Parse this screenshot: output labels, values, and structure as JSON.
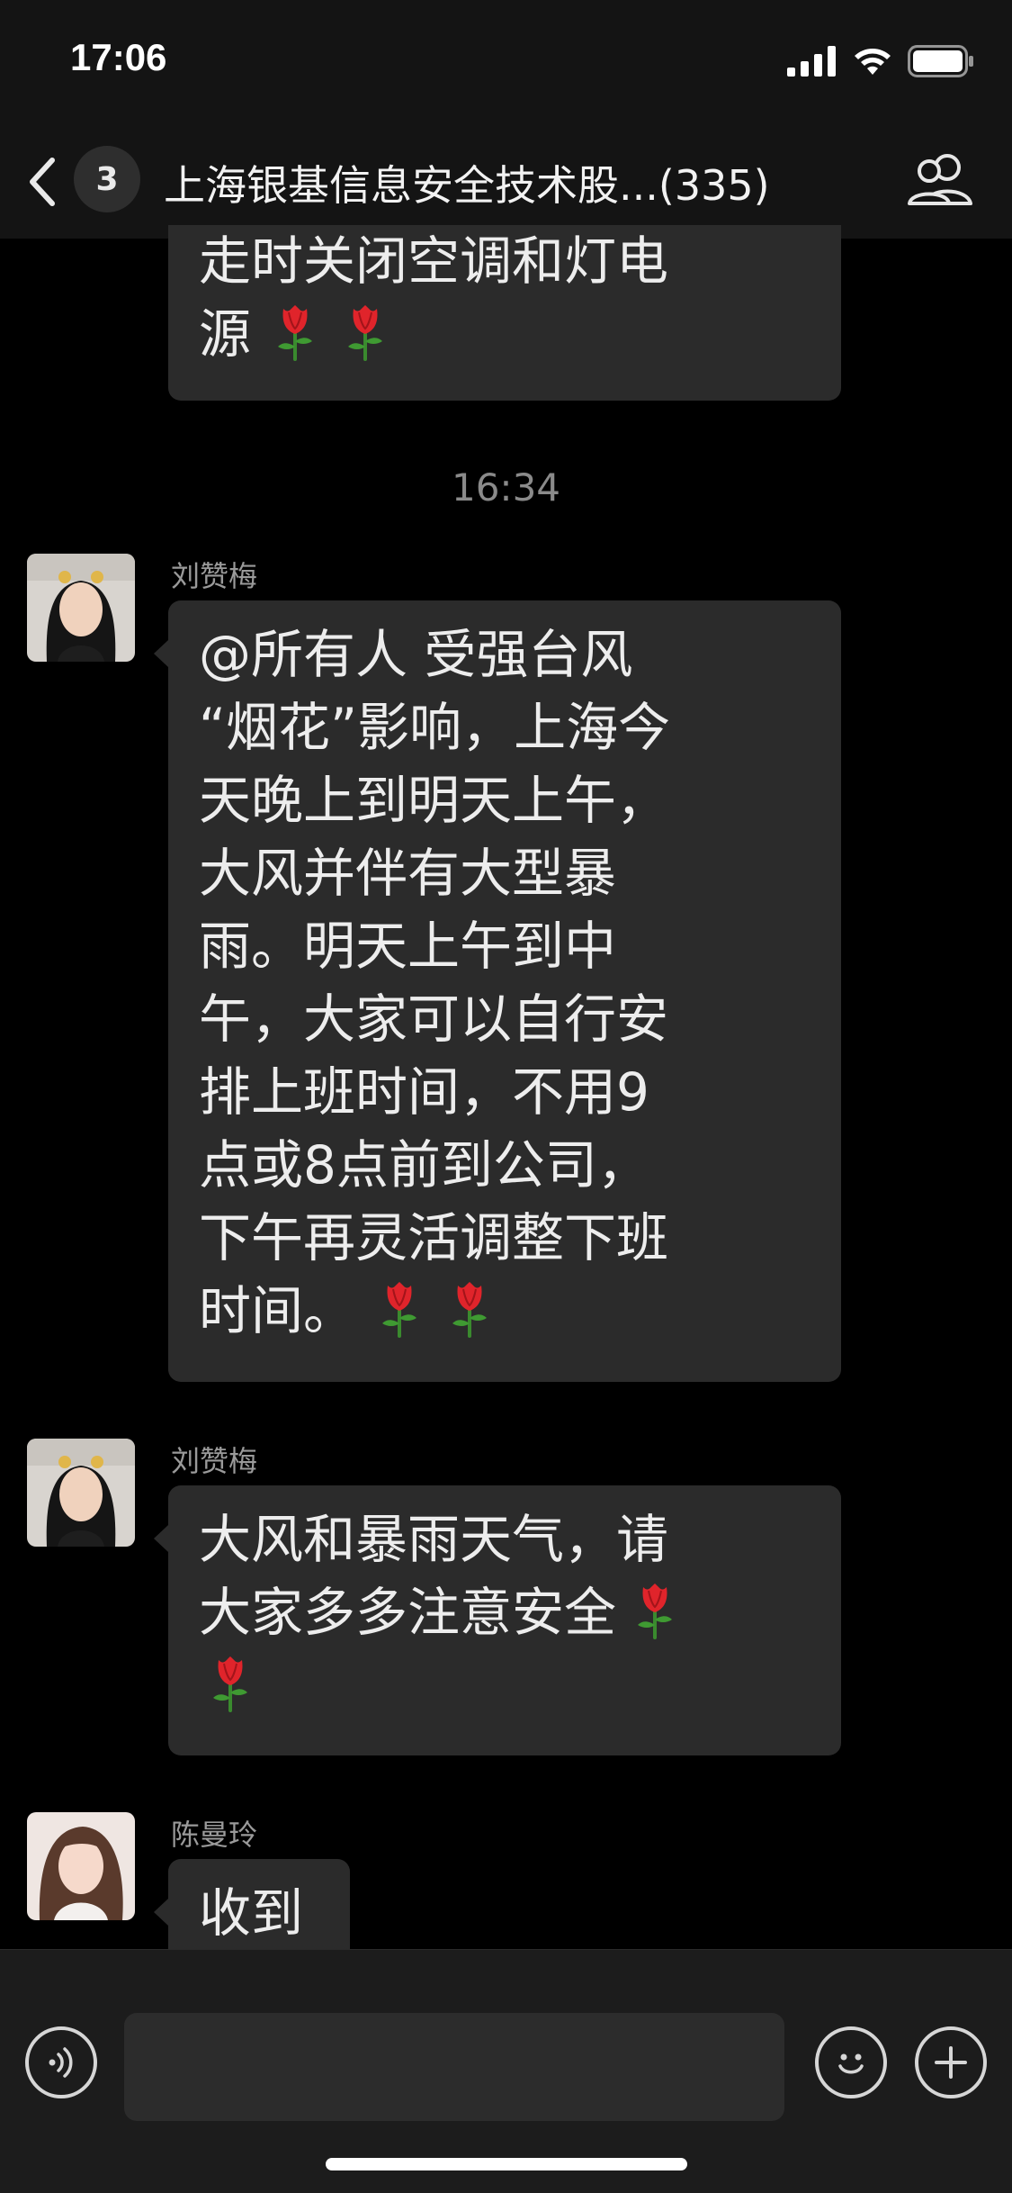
{
  "status_bar": {
    "time": "17:06"
  },
  "nav": {
    "unread_count": "3",
    "title": "上海银基信息安全技术股...(335)"
  },
  "messages": [
    {
      "sender": "",
      "lines": [
        "走时关闭空调和灯电",
        "源"
      ],
      "emoji_after": [
        "rose",
        "rose"
      ]
    },
    {
      "time_divider": "16:34"
    },
    {
      "sender": "刘赞梅",
      "lines": [
        "@所有人 受强台风",
        "“烟花”影响，上海今",
        "天晚上到明天上午，",
        "大风并伴有大型暴",
        "雨。明天上午到中",
        "午，大家可以自行安",
        "排上班时间，不用9",
        "点或8点前到公司，",
        "下午再灵活调整下班",
        "时间。"
      ],
      "emoji_after": [
        "rose",
        "rose"
      ]
    },
    {
      "sender": "刘赞梅",
      "lines": [
        "大风和暴雨天气，请",
        "大家多多注意安全"
      ],
      "emoji_after": [
        "rose",
        "rose"
      ]
    },
    {
      "sender": "陈曼玲",
      "lines": [
        "收到"
      ]
    }
  ],
  "colors": {
    "background": "#000000",
    "bubble": "#2b2b2b",
    "bar": "#141414",
    "rose": "#e0242b"
  },
  "icons": [
    "back-chevron-icon",
    "members-icon",
    "voice-icon",
    "emoji-icon",
    "plus-icon",
    "rose-emoji",
    "signal-icon",
    "wifi-icon",
    "battery-icon"
  ]
}
